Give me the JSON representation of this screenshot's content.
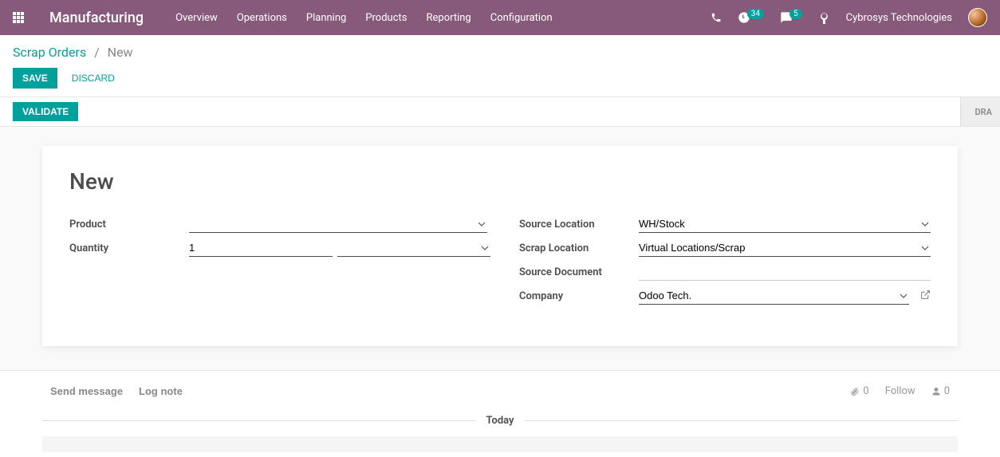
{
  "navbar": {
    "brand": "Manufacturing",
    "menu": [
      "Overview",
      "Operations",
      "Planning",
      "Products",
      "Reporting",
      "Configuration"
    ],
    "activities_count": "34",
    "messages_count": "5",
    "company": "Cybrosys Technologies"
  },
  "breadcrumbs": {
    "root": "Scrap Orders",
    "current": "New"
  },
  "buttons": {
    "save": "Save",
    "discard": "Discard",
    "validate": "Validate"
  },
  "status": {
    "draft": "DRA"
  },
  "form": {
    "title": "New",
    "labels": {
      "product": "Product",
      "quantity": "Quantity",
      "source_location": "Source Location",
      "scrap_location": "Scrap Location",
      "source_document": "Source Document",
      "company": "Company"
    },
    "values": {
      "product": "",
      "quantity": "1",
      "uom": "",
      "source_location": "WH/Stock",
      "scrap_location": "Virtual Locations/Scrap",
      "source_document": "",
      "company": "Odoo Tech."
    }
  },
  "chatter": {
    "send_message": "Send message",
    "log_note": "Log note",
    "attachments": "0",
    "follow": "Follow",
    "followers": "0",
    "today": "Today"
  }
}
